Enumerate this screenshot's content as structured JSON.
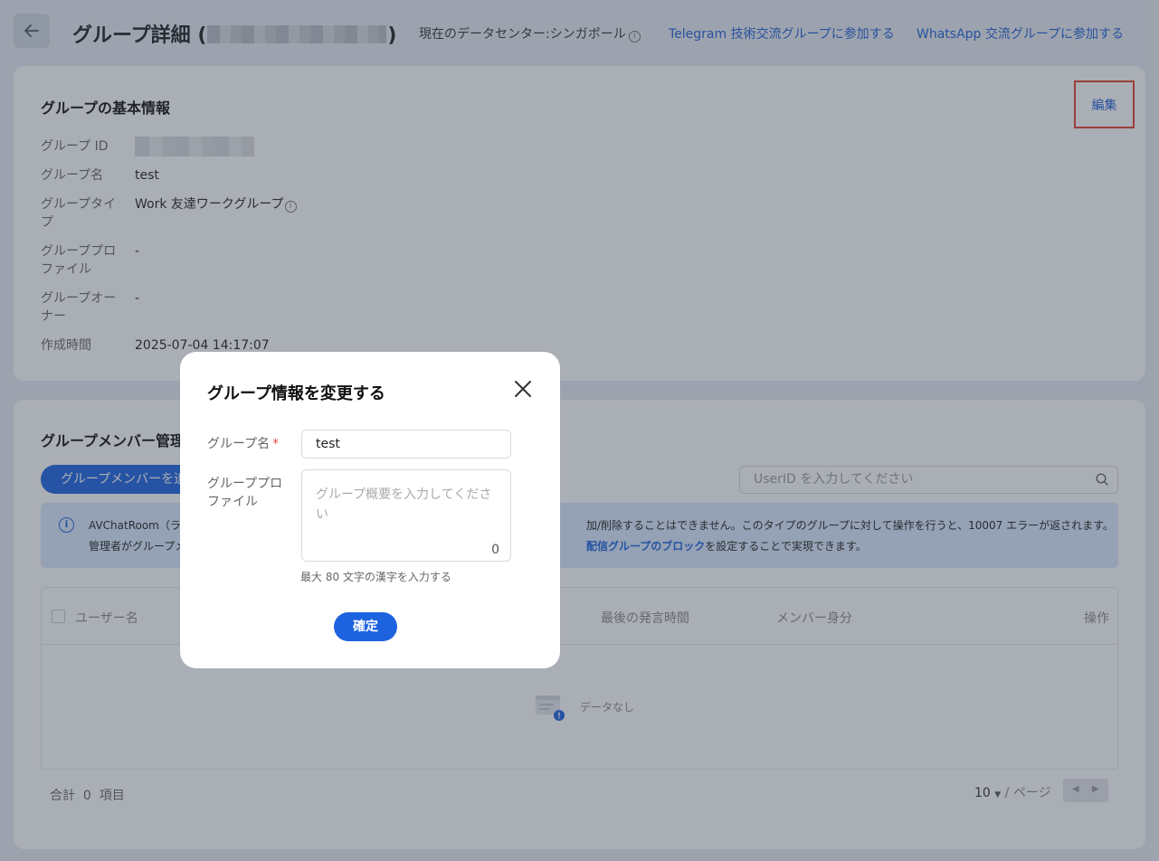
{
  "header": {
    "title_prefix": "グループ詳細 (",
    "title_suffix": ")",
    "datacenter_label": "現在のデータセンター:シンガポール",
    "telegram_link": "Telegram 技術交流グループに参加する",
    "whatsapp_link": "WhatsApp 交流グループに参加する"
  },
  "basic_info": {
    "title": "グループの基本情報",
    "edit_label": "編集",
    "rows": [
      {
        "label": "グループ ID",
        "value": ""
      },
      {
        "label": "グループ名",
        "value": "test"
      },
      {
        "label": "グループタイプ",
        "value": "Work 友達ワークグループ"
      },
      {
        "label": "グループプロファイル",
        "value": "-"
      },
      {
        "label": "グループオーナー",
        "value": "-"
      },
      {
        "label": "作成時間",
        "value": "2025-07-04 14:17:07"
      }
    ]
  },
  "members": {
    "title": "グループメンバー管理",
    "add_button": "グループメンバーを追",
    "search_placeholder": "UserID を入力してください",
    "notice": {
      "line1_left": "AVChatRoom（ライ",
      "line1_right": "加/削除することはできません。このタイプのグループに対して操作を行うと、10007 エラーが返されます。",
      "line2_left": "管理者がグループメ",
      "line2_link": "配信グループのブロック",
      "line2_right": "を設定することで実現できます。"
    },
    "columns": {
      "username": "ユーザー名",
      "last_message": "最後の発言時間",
      "role": "メンバー身分",
      "actions": "操作"
    },
    "empty_text": "データなし",
    "total_label": "合計",
    "total_count": "0",
    "total_unit": "項目",
    "page_size": "10",
    "page_unit": "/ ページ"
  },
  "modal": {
    "title": "グループ情報を変更する",
    "name_label": "グループ名",
    "name_value": "test",
    "profile_label": "グループプロファイル",
    "profile_placeholder": "グループ概要を入力してください",
    "profile_count": "0",
    "hint": "最大 80 文字の漢字を入力する",
    "confirm": "確定"
  },
  "colors": {
    "primary": "#1d63e0",
    "highlight_border": "#e5402f"
  }
}
